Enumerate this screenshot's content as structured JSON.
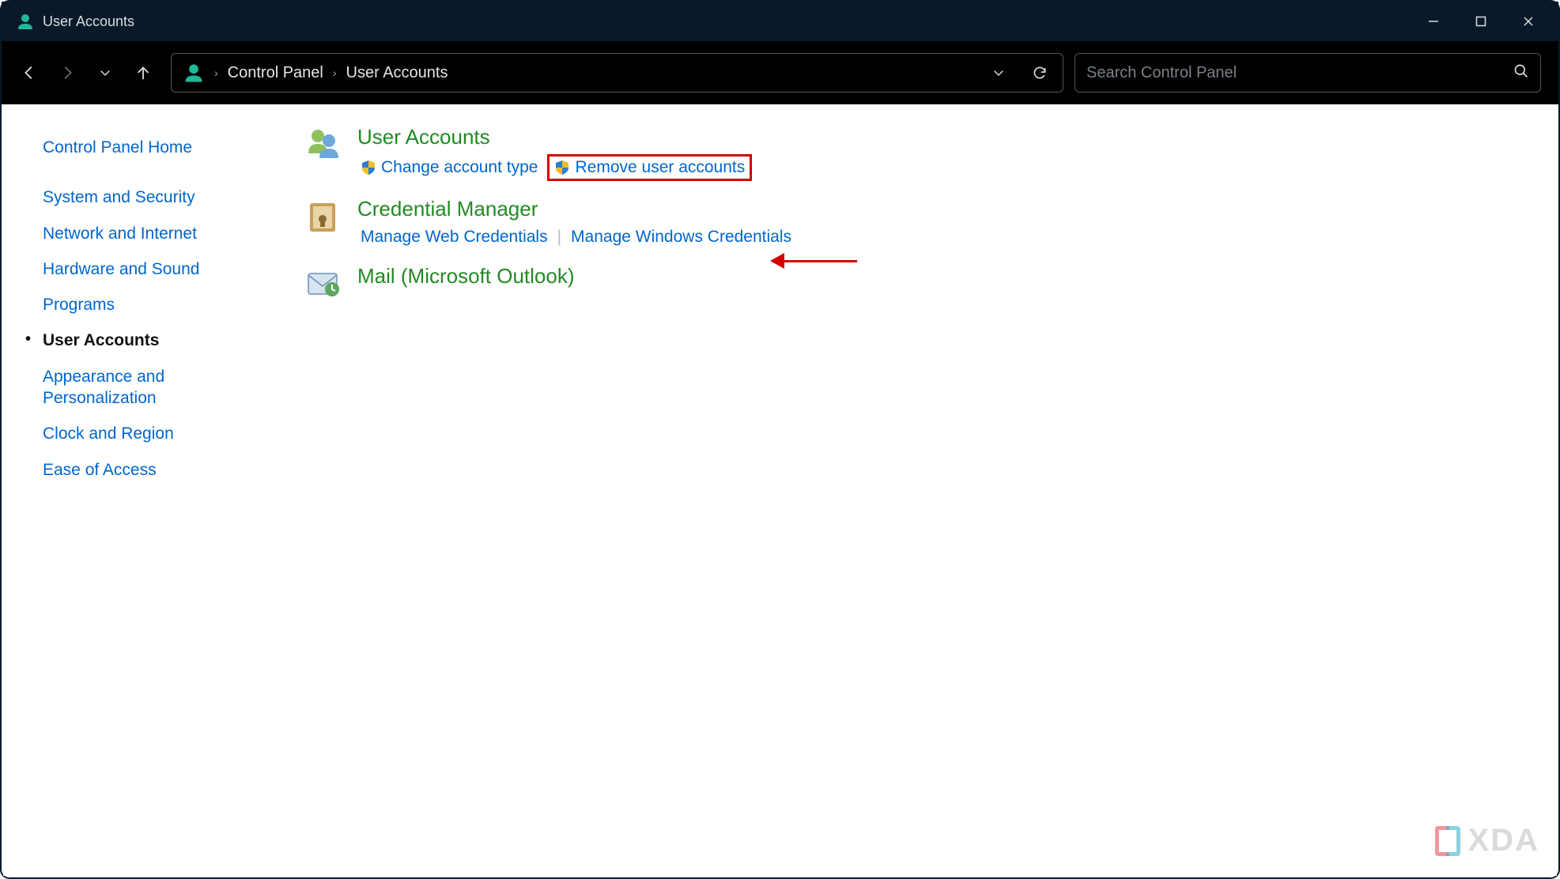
{
  "window": {
    "title": "User Accounts"
  },
  "breadcrumbs": {
    "root": "Control Panel",
    "current": "User Accounts"
  },
  "search": {
    "placeholder": "Search Control Panel"
  },
  "sidebar": {
    "home": "Control Panel Home",
    "items": [
      "System and Security",
      "Network and Internet",
      "Hardware and Sound",
      "Programs",
      "User Accounts",
      "Appearance and Personalization",
      "Clock and Region",
      "Ease of Access"
    ],
    "active_index": 4
  },
  "main": {
    "categories": [
      {
        "title": "User Accounts",
        "icon": "user-accounts-icon",
        "links": [
          {
            "label": "Change account type",
            "shield": true,
            "highlighted": false
          },
          {
            "label": "Remove user accounts",
            "shield": true,
            "highlighted": true
          }
        ]
      },
      {
        "title": "Credential Manager",
        "icon": "credential-manager-icon",
        "links": [
          {
            "label": "Manage Web Credentials",
            "shield": false,
            "highlighted": false
          },
          {
            "label": "Manage Windows Credentials",
            "shield": false,
            "highlighted": false
          }
        ]
      },
      {
        "title": "Mail (Microsoft Outlook)",
        "icon": "mail-icon",
        "links": []
      }
    ]
  },
  "watermark": "XDA",
  "colors": {
    "link": "#0066cc",
    "heading": "#228b22",
    "highlight": "#d30000",
    "titlebar": "#0a1929"
  }
}
